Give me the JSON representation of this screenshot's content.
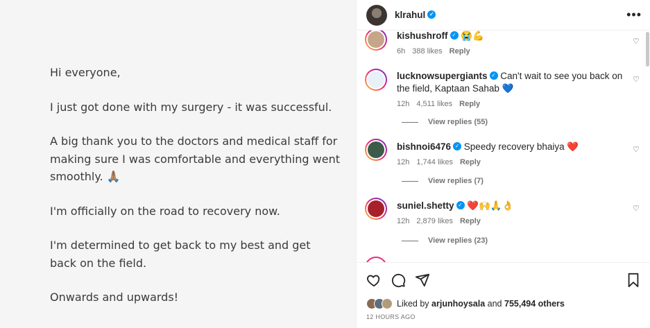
{
  "post": {
    "lines": [
      "Hi everyone,",
      "I just got done with my surgery - it was successful.",
      "A big thank you to the doctors and medical staff for",
      "making sure I was comfortable and everything went",
      "smoothly. 🙏🏽",
      "I'm officially on the road to recovery now.",
      "I'm determined to get back to my best and get",
      "back on the field.",
      "Onwards and upwards!"
    ]
  },
  "header": {
    "username": "klrahul",
    "more_label": "•••"
  },
  "comments": [
    {
      "username": "kishushroff",
      "text": "😭💪",
      "time": "6h",
      "likes": "388 likes",
      "reply": "Reply",
      "avatar_color": "#c7a58a"
    },
    {
      "username": "lucknowsupergiants",
      "text": "Can't wait to see you back on the field, Kaptaan Sahab 💙",
      "time": "12h",
      "likes": "4,511 likes",
      "reply": "Reply",
      "view_replies": "View replies (55)",
      "avatar_color": "#1e77c6"
    },
    {
      "username": "bishnoi6476",
      "text": "Speedy recovery bhaiya ❤️",
      "time": "12h",
      "likes": "1,744 likes",
      "reply": "Reply",
      "view_replies": "View replies (7)",
      "avatar_color": "#3d5a4a"
    },
    {
      "username": "suniel.shetty",
      "text": "❤️🙌🙏👌",
      "time": "12h",
      "likes": "2,879 likes",
      "reply": "Reply",
      "view_replies": "View replies (23)",
      "avatar_color": "#a8202a"
    }
  ],
  "likes": {
    "prefix": "Liked by",
    "user": "arjunhoysala",
    "middle": "and",
    "count": "755,494 others"
  },
  "timestamp": "12 HOURS AGO"
}
